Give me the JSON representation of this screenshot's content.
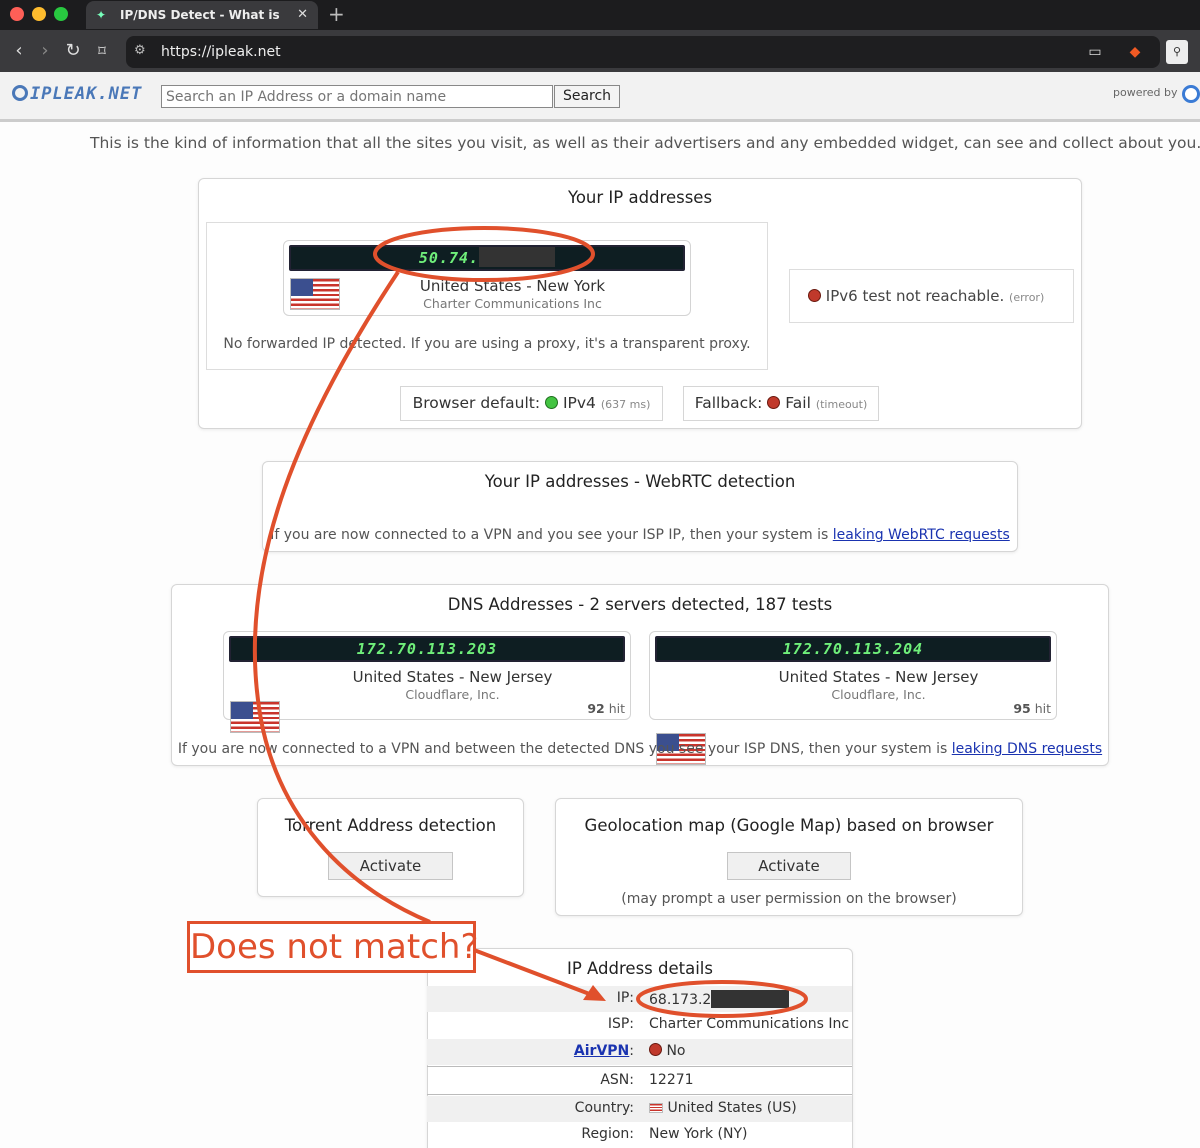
{
  "browser": {
    "tab_title": "IP/DNS Detect - What is your IP",
    "tab_close": "✕",
    "new_tab": "+",
    "url": "https://ipleak.net"
  },
  "header": {
    "logo_text": "IPLEAK.NET",
    "search_placeholder": "Search an IP Address or a domain name",
    "search_button": "Search",
    "powered_by": "powered by"
  },
  "intro": "This is the kind of information that all the sites you visit, as well as their advertisers and any embedded widget, can see and collect about you.",
  "ip_card": {
    "title": "Your IP addresses",
    "ip": "50.74.",
    "location": "United States - New York",
    "isp": "Charter Communications Inc",
    "forward_note": "No forwarded IP detected. If you are using a proxy, it's a transparent proxy.",
    "ipv6_text": "IPv6 test not reachable.",
    "ipv6_status": "(error)",
    "browser_default_label": "Browser default:",
    "browser_default_value": "IPv4",
    "browser_default_ms": "(637 ms)",
    "fallback_label": "Fallback:",
    "fallback_value": "Fail",
    "fallback_status": "(timeout)"
  },
  "webrtc": {
    "title": "Your IP addresses - WebRTC detection",
    "note": "If you are now connected to a VPN and you see your ISP IP, then your system is",
    "link": "leaking WebRTC requests"
  },
  "dns": {
    "title": "DNS Addresses - 2 servers detected, 187 tests",
    "servers": [
      {
        "ip": "172.70.113.203",
        "location": "United States - New Jersey",
        "isp": "Cloudflare, Inc.",
        "hits": "92",
        "hit_label": "hit"
      },
      {
        "ip": "172.70.113.204",
        "location": "United States - New Jersey",
        "isp": "Cloudflare, Inc.",
        "hits": "95",
        "hit_label": "hit"
      }
    ],
    "note": "If you are now connected to a VPN and between the detected DNS you see your ISP DNS, then your system is",
    "link": "leaking DNS requests"
  },
  "torrent": {
    "title": "Torrent Address detection",
    "button": "Activate"
  },
  "geo": {
    "title": "Geolocation map (Google Map) based on browser",
    "button": "Activate",
    "note": "(may prompt a user permission on the browser)"
  },
  "details": {
    "title": "IP Address details",
    "rows": [
      {
        "key": "IP:",
        "value": "68.173.2"
      },
      {
        "key": "ISP:",
        "value": "Charter Communications Inc"
      },
      {
        "key": "AirVPN",
        "value": "No"
      },
      {
        "key": "ASN:",
        "value": "12271"
      },
      {
        "key": "Country:",
        "value": "United States (US)"
      },
      {
        "key": "Region:",
        "value": "New York (NY)"
      }
    ]
  },
  "annotation": {
    "callout": "Does not match?",
    "color": "#e0502c"
  },
  "colors": {
    "led_text": "#6fef7a",
    "led_bg": "#0e1e22",
    "link": "#1a33b0"
  }
}
